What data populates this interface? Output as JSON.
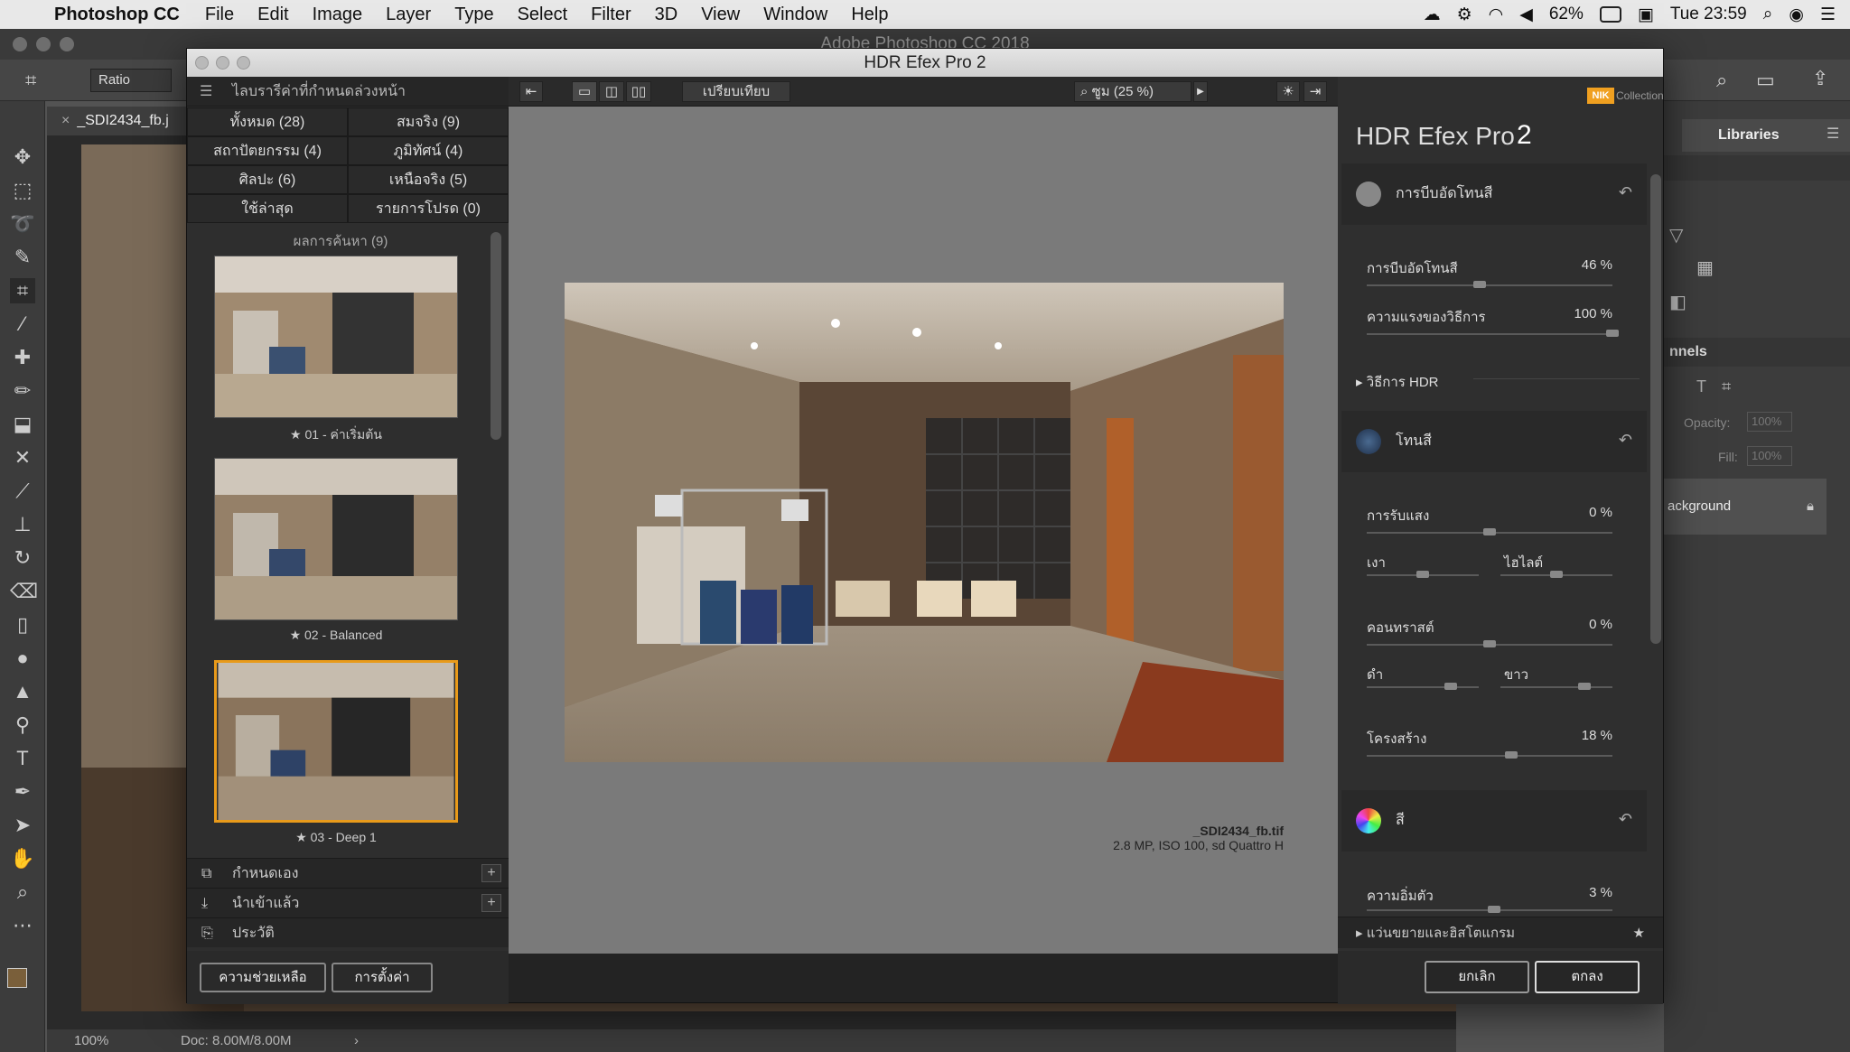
{
  "menubar": {
    "app": "Photoshop CC",
    "items": [
      "File",
      "Edit",
      "Image",
      "Layer",
      "Type",
      "Select",
      "Filter",
      "3D",
      "View",
      "Window",
      "Help"
    ],
    "battery": "62%",
    "clock": "Tue 23:59"
  },
  "photoshop": {
    "window_title": "Adobe Photoshop CC 2018",
    "ratio_label": "Ratio",
    "doc_tab": "_SDI2434_fb.j",
    "zoom": "100%",
    "doc_info": "Doc: 8.00M/8.00M",
    "right_tab": "Libraries",
    "channels_label": "nnels",
    "opacity_label": "Opacity:",
    "opacity_value": "100%",
    "fill_label": "Fill:",
    "fill_value": "100%",
    "layer_name": "ackground"
  },
  "dialog": {
    "title": "HDR Efex Pro 2",
    "preset_header": "ไลบรารีค่าที่กำหนดล่วงหน้า",
    "categories": [
      "ทั้งหมด (28)",
      "สมจริง (9)",
      "สถาปัตยกรรม (4)",
      "ภูมิทัศน์ (4)",
      "ศิลปะ (6)",
      "เหนือจริง (5)",
      "ใช้ล่าสุด",
      "รายการโปรด (0)"
    ],
    "results_label": "ผลการค้นหา (9)",
    "presets": [
      "★ 01 - ค่าเริ่มต้น",
      "★ 02 - Balanced",
      "★ 03 - Deep 1"
    ],
    "accordions": [
      "กำหนดเอง",
      "นำเข้าแล้ว",
      "ประวัติ"
    ],
    "help_button": "ความช่วยเหลือ",
    "settings_button": "การตั้งค่า",
    "compare_button": "เปรียบเทียบ",
    "zoom_label": "ซูม (25 %)",
    "file_name": "_SDI2434_fb.tif",
    "file_info": "2.8 MP, ISO 100, sd Quattro H",
    "brand_logo": "NIK",
    "brand_collection": "Collection",
    "product_name": "HDR Efex Pro",
    "product_version": "2",
    "sections": {
      "tone_compression": {
        "title": "การบีบอัดโทนสี",
        "slider1_label": "การบีบอัดโทนสี",
        "slider1_value": "46 %",
        "slider1_level": 0.46,
        "slider2_label": "ความแรงของวิธีการ",
        "slider2_value": "100 %",
        "slider2_level": 1.0,
        "hdr_method": "วิธีการ HDR"
      },
      "tonality": {
        "title": "โทนสี",
        "exposure_label": "การรับแสง",
        "exposure_value": "0 %",
        "shadows_label": "เงา",
        "highlights_label": "ไฮไลต์",
        "contrast_label": "คอนทราสต์",
        "contrast_value": "0 %",
        "blacks_label": "ดำ",
        "whites_label": "ขาว",
        "structure_label": "โครงสร้าง",
        "structure_value": "18 %"
      },
      "color": {
        "title": "สี",
        "saturation_label": "ความอิ่มตัว",
        "saturation_value": "3 %"
      }
    },
    "loupe_label": "แว่นขยายและฮิสโตแกรม",
    "cancel_button": "ยกเลิก",
    "ok_button": "ตกลง"
  }
}
